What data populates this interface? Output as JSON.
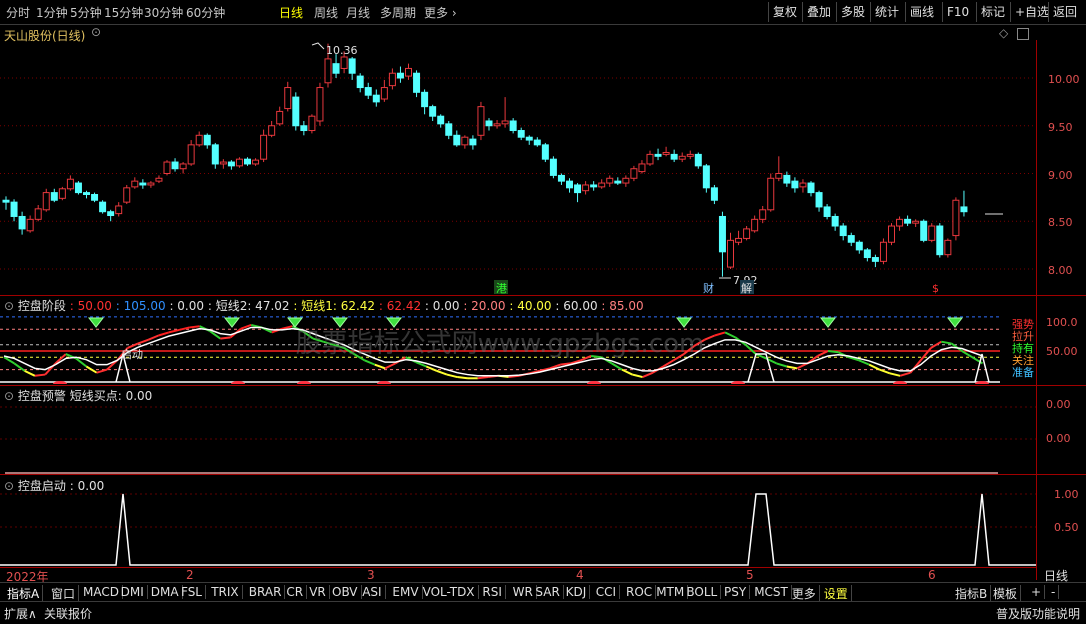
{
  "toolbar": {
    "period_tabs": [
      "分时",
      "1分钟",
      "5分钟",
      "15分钟",
      "30分钟",
      "60分钟",
      "日线",
      "周线",
      "月线",
      "多周期",
      "更多"
    ],
    "active_tab": "日线",
    "right_buttons": [
      "复权",
      "叠加",
      "多股",
      "统计",
      "画线",
      "F10",
      "标记",
      "+自选",
      "返回"
    ]
  },
  "stock": {
    "title": "天山股份(日线)"
  },
  "main_chart": {
    "high_label": "10.36",
    "low_label": "7.92",
    "y_ticks": [
      "10.00",
      "9.50",
      "9.00",
      "8.50",
      "8.00"
    ],
    "event_labels": [
      "港",
      "财",
      "解",
      "$"
    ],
    "colors": {
      "up": "#e8383d",
      "down": "#54ffff"
    }
  },
  "indicator1": {
    "name": "控盘阶段",
    "values": [
      {
        "text": "50.00",
        "color": "#ff3030"
      },
      {
        "text": "105.00",
        "color": "#3090ff"
      },
      {
        "text": "0.00",
        "color": "#e0e0e0"
      },
      {
        "text": "短线2: 47.02",
        "color": "#e0e0e0"
      },
      {
        "text": "短线1: 62.42",
        "color": "#ffff40"
      },
      {
        "text": "62.42",
        "color": "#ff3030"
      },
      {
        "text": "0.00",
        "color": "#e0e0e0"
      },
      {
        "text": "20.00",
        "color": "#ff8080"
      },
      {
        "text": "40.00",
        "color": "#ffff40"
      },
      {
        "text": "60.00",
        "color": "#e0e0e0"
      },
      {
        "text": "85.00",
        "color": "#ff8080"
      }
    ],
    "y_ticks": [
      "100.0",
      "50.00"
    ],
    "zone_labels": [
      {
        "text": "强势",
        "color": "#ff3030"
      },
      {
        "text": "拉升",
        "color": "#ff6040"
      },
      {
        "text": "持有",
        "color": "#30ff30"
      },
      {
        "text": "关注",
        "color": "#ffa030"
      },
      {
        "text": "准备",
        "color": "#40c0ff"
      }
    ],
    "start_label": "启动",
    "watermark": "股票指标公式网www.gpzbgs.com"
  },
  "indicator2": {
    "name": "控盘预警",
    "value_label": "短线买点: 0.00",
    "y_ticks": [
      "0.00",
      "0.00"
    ]
  },
  "indicator3": {
    "name": "控盘启动",
    "value_label": ": 0.00",
    "y_ticks": [
      "1.00",
      "0.50"
    ]
  },
  "date_axis": {
    "labels": [
      "2022年",
      "2",
      "3",
      "4",
      "5",
      "6"
    ],
    "period": "日线"
  },
  "indicator_tabs": [
    "指标A",
    "窗口",
    "MACD",
    "DMI",
    "DMA",
    "FSL",
    "TRIX",
    "BRAR",
    "CR",
    "VR",
    "OBV",
    "ASI",
    "EMV",
    "VOL-TDX",
    "RSI",
    "WR",
    "SAR",
    "KDJ",
    "CCI",
    "ROC",
    "MTM",
    "BOLL",
    "PSY",
    "MCST",
    "更多",
    "设置"
  ],
  "right_tabs": [
    "指标B",
    "模板",
    "+",
    "-"
  ],
  "status": {
    "expand": "扩展∧",
    "related": "关联报价",
    "help": "普及版功能说明"
  }
}
